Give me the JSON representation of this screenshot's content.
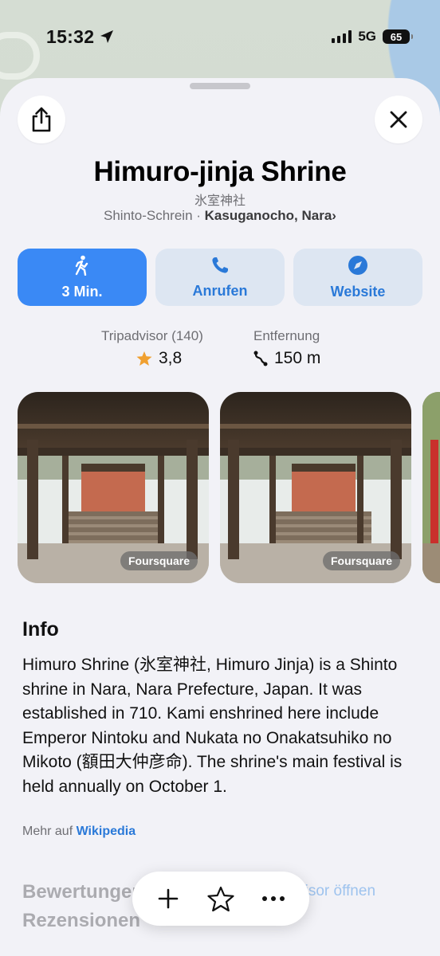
{
  "status_bar": {
    "time": "15:32",
    "network": "5G",
    "battery": "65"
  },
  "place": {
    "name": "Himuro-jinja Shrine",
    "native_name": "氷室神社",
    "category": "Shinto-Schrein",
    "separator": " · ",
    "location": "Kasuganocho, Nara"
  },
  "actions": {
    "route_label": "3 Min.",
    "call_label": "Anrufen",
    "website_label": "Website"
  },
  "stats": {
    "rating_label": "Tripadvisor (140)",
    "rating_value": "3,8",
    "distance_label": "Entfernung",
    "distance_value": "150 m"
  },
  "photos": [
    {
      "source": "Foursquare"
    },
    {
      "source": "Foursquare"
    }
  ],
  "info": {
    "title": "Info",
    "body": "Himuro Shrine (氷室神社, Himuro Jinja) is a Shinto shrine in Nara, Nara Prefecture, Japan. It was established in 710. Kami enshrined here include Emperor Nintoku and Nukata no Onakatsuhiko no Mikoto (額田大仲彦命). The shrine's main festival is held annually on October 1.",
    "more_prefix": "Mehr auf ",
    "more_link": "Wikipedia"
  },
  "reviews": {
    "title_line1": "Bewertungen &",
    "title_line2": "Rezensionen",
    "open_label": "advisor öffnen"
  },
  "colors": {
    "accent": "#3a89f5",
    "link": "#2a79d8",
    "star": "#f0a030",
    "sheet_bg": "#f2f2f7"
  },
  "icons": {
    "share": "share-icon",
    "close": "close-icon",
    "walk": "walk-icon",
    "phone": "phone-icon",
    "compass": "compass-icon",
    "star": "star-icon",
    "distance": "distance-icon",
    "add": "plus-icon",
    "favorite": "star-outline-icon",
    "more": "ellipsis-icon"
  }
}
